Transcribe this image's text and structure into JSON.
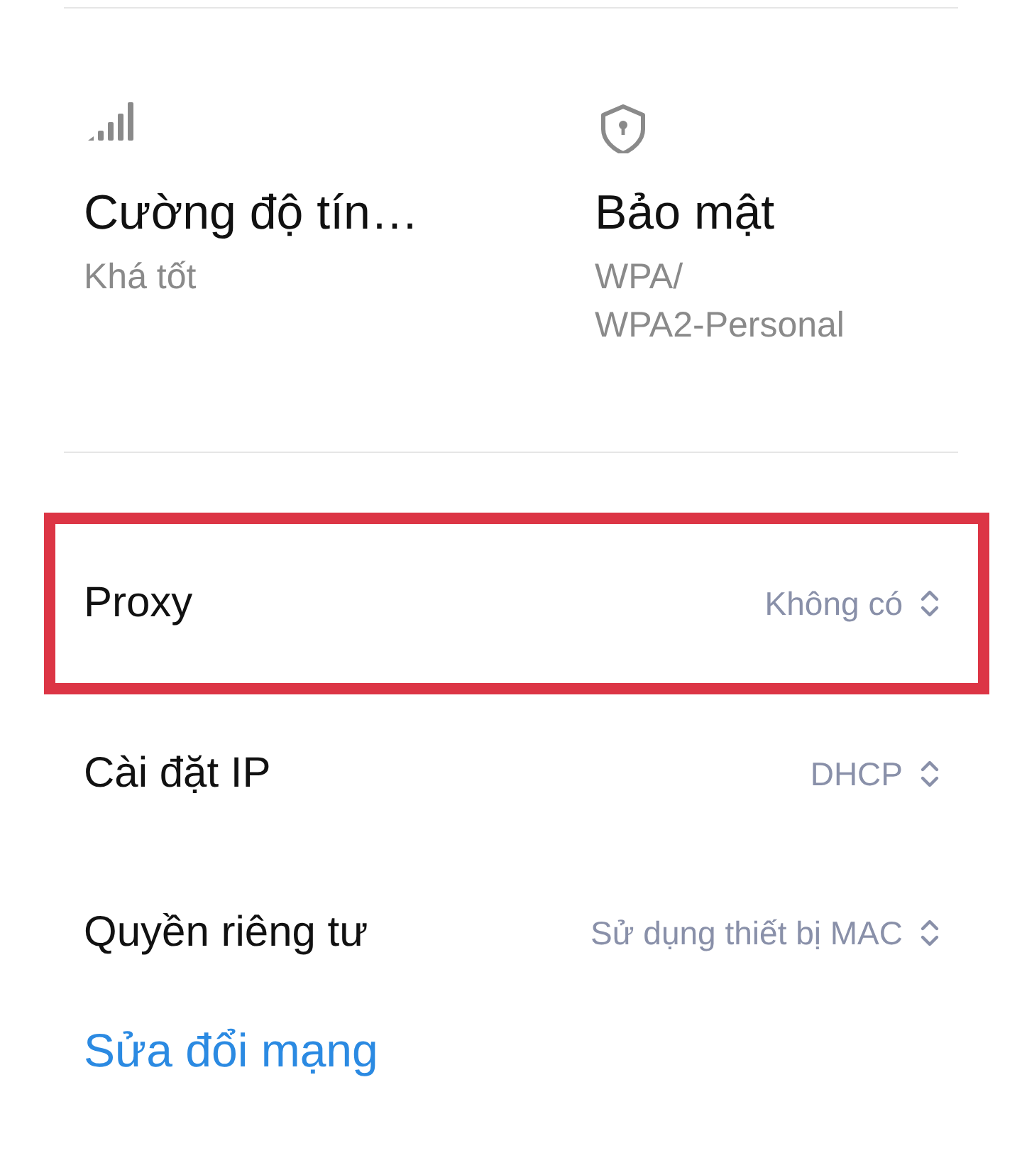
{
  "info": [
    {
      "kind": "signal",
      "title": "Cường độ tín…",
      "value": "Khá tốt"
    },
    {
      "kind": "security",
      "title": "Bảo mật",
      "value": "WPA/\nWPA2-Personal"
    }
  ],
  "settings": [
    {
      "label": "Proxy",
      "value": "Không có",
      "highlighted": true
    },
    {
      "label": "Cài đặt IP",
      "value": "DHCP",
      "highlighted": false
    },
    {
      "label": "Quyền riêng tư",
      "value": "Sử dụng thiết bị MAC",
      "highlighted": false
    }
  ],
  "link": "Sửa đổi mạng"
}
